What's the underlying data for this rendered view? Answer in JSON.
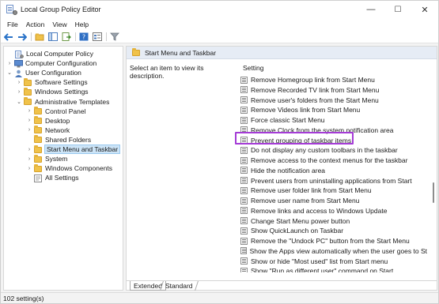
{
  "window": {
    "title": "Local Group Policy Editor",
    "minimize": "—",
    "maximize": "☐",
    "close": "✕"
  },
  "menu": [
    "File",
    "Action",
    "View",
    "Help"
  ],
  "tree": [
    {
      "label": "Local Computer Policy",
      "depth": 0,
      "chevron": "",
      "icon": "policy",
      "selected": false
    },
    {
      "label": "Computer Configuration",
      "depth": 1,
      "chevron": "›",
      "icon": "computer",
      "selected": false
    },
    {
      "label": "User Configuration",
      "depth": 1,
      "chevron": "⌄",
      "icon": "user",
      "selected": false
    },
    {
      "label": "Software Settings",
      "depth": 2,
      "chevron": "›",
      "icon": "folder",
      "selected": false
    },
    {
      "label": "Windows Settings",
      "depth": 2,
      "chevron": "›",
      "icon": "folder",
      "selected": false
    },
    {
      "label": "Administrative Templates",
      "depth": 2,
      "chevron": "⌄",
      "icon": "folder",
      "selected": false
    },
    {
      "label": "Control Panel",
      "depth": 3,
      "chevron": "›",
      "icon": "folder",
      "selected": false
    },
    {
      "label": "Desktop",
      "depth": 3,
      "chevron": "›",
      "icon": "folder",
      "selected": false
    },
    {
      "label": "Network",
      "depth": 3,
      "chevron": "›",
      "icon": "folder",
      "selected": false
    },
    {
      "label": "Shared Folders",
      "depth": 3,
      "chevron": "",
      "icon": "folder",
      "selected": false
    },
    {
      "label": "Start Menu and Taskbar",
      "depth": 3,
      "chevron": "›",
      "icon": "folder",
      "selected": true
    },
    {
      "label": "System",
      "depth": 3,
      "chevron": "›",
      "icon": "folder",
      "selected": false
    },
    {
      "label": "Windows Components",
      "depth": 3,
      "chevron": "›",
      "icon": "folder",
      "selected": false
    },
    {
      "label": "All Settings",
      "depth": 3,
      "chevron": "",
      "icon": "settings",
      "selected": false
    }
  ],
  "right_pane": {
    "header": "Start Menu and Taskbar",
    "description": "Select an item to view its description.",
    "column_header": "Setting",
    "settings": [
      "Remove Homegroup link from Start Menu",
      "Remove Recorded TV link from Start Menu",
      "Remove user's folders from the Start Menu",
      "Remove Videos link from Start Menu",
      "Force classic Start Menu",
      "Remove Clock from the system notification area",
      "Prevent grouping of taskbar items",
      "Do not display any custom toolbars in the taskbar",
      "Remove access to the context menus for the taskbar",
      "Hide the notification area",
      "Prevent users from uninstalling applications from Start",
      "Remove user folder link from Start Menu",
      "Remove user name from Start Menu",
      "Remove links and access to Windows Update",
      "Change Start Menu power button",
      "Show QuickLaunch on Taskbar",
      "Remove the \"Undock PC\" button from the Start Menu",
      "Show the Apps view automatically when the user goes to St",
      "Show or hide \"Most used\" list from Start menu",
      "Show \"Run as different user\" command on Start"
    ],
    "highlighted_index": 6,
    "highlight_color": "#a43bd6",
    "tabs": [
      "Extended",
      "Standard"
    ],
    "active_tab": 0
  },
  "status": "102 setting(s)"
}
